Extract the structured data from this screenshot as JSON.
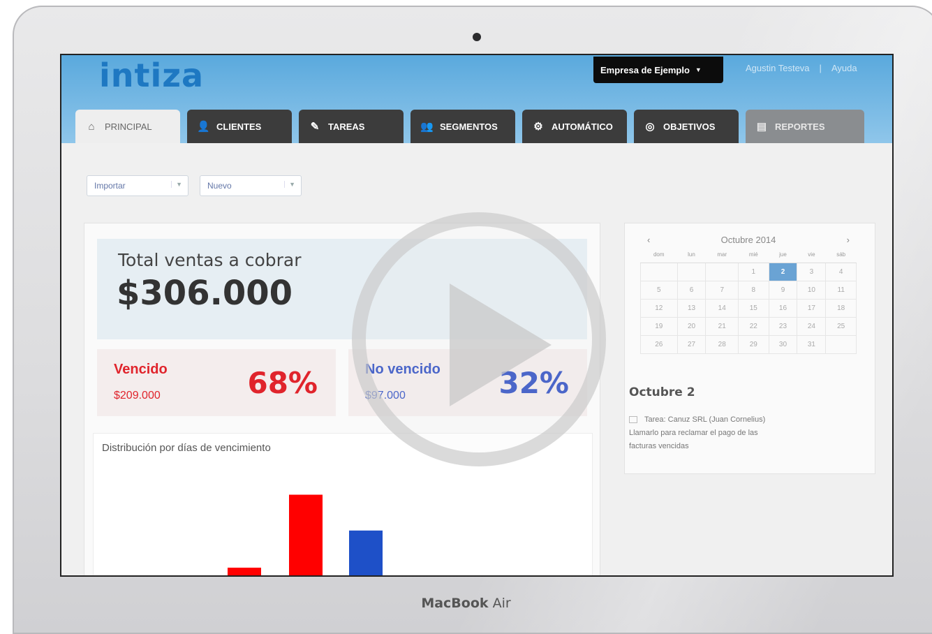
{
  "device": {
    "brand_bold": "MacBook",
    "brand_model": "Air"
  },
  "app": {
    "logo": "intiza"
  },
  "header": {
    "company": "Empresa de Ejemplo",
    "user_links": [
      "Agustin Testeva",
      "|",
      "Ayuda"
    ]
  },
  "tabs": [
    {
      "label": "PRINCIPAL",
      "icon": "home-icon",
      "glyph": "⌂"
    },
    {
      "label": "CLIENTES",
      "icon": "user-icon",
      "glyph": "👤"
    },
    {
      "label": "TAREAS",
      "icon": "task-check-icon",
      "glyph": "✎"
    },
    {
      "label": "SEGMENTOS",
      "icon": "group-icon",
      "glyph": "👥"
    },
    {
      "label": "AUTOMÁTICO",
      "icon": "gears-icon",
      "glyph": "⚙"
    },
    {
      "label": "OBJETIVOS",
      "icon": "target-icon",
      "glyph": "◎"
    },
    {
      "label": "REPORTES",
      "icon": "chart-icon",
      "glyph": "▤"
    }
  ],
  "toolbar": {
    "import_label": "Importar",
    "new_label": "Nuevo"
  },
  "summary": {
    "total_label": "Total ventas a cobrar",
    "total_value": "$306.000",
    "overdue_label": "Vencido",
    "overdue_amount": "$209.000",
    "overdue_pct": "68%",
    "current_label": "No vencido",
    "current_amount": "$97.000",
    "current_pct": "32%"
  },
  "chart_data": {
    "type": "bar",
    "title": "Distribución por días de vencimiento",
    "categories": [
      "",
      "",
      ""
    ],
    "values": [
      20,
      75,
      48
    ],
    "colors": [
      "#ff0000",
      "#ff0000",
      "#1e50c8"
    ],
    "xlabel": "",
    "ylabel": "",
    "ylim": [
      0,
      100
    ]
  },
  "calendar": {
    "month_label": "Octubre 2014",
    "weekdays": [
      "dom",
      "lun",
      "mar",
      "mié",
      "jue",
      "vie",
      "sáb"
    ],
    "weeks": [
      [
        "",
        "",
        "",
        "1",
        "2",
        "3",
        "4"
      ],
      [
        "5",
        "6",
        "7",
        "8",
        "9",
        "10",
        "11"
      ],
      [
        "12",
        "13",
        "14",
        "15",
        "16",
        "17",
        "18"
      ],
      [
        "19",
        "20",
        "21",
        "22",
        "23",
        "24",
        "25"
      ],
      [
        "26",
        "27",
        "28",
        "29",
        "30",
        "31",
        ""
      ]
    ],
    "selected": "2"
  },
  "agenda": {
    "day_title": "Octubre 2",
    "task_line1": "Tarea: Canuz SRL (Juan Cornelius)",
    "task_line2": "Llamarlo para reclamar el pago de las",
    "task_line3": "facturas vencidas"
  },
  "colors": {
    "overdue": "#e0242c",
    "current": "#2f4fc4",
    "header": "#5aa9dd"
  }
}
